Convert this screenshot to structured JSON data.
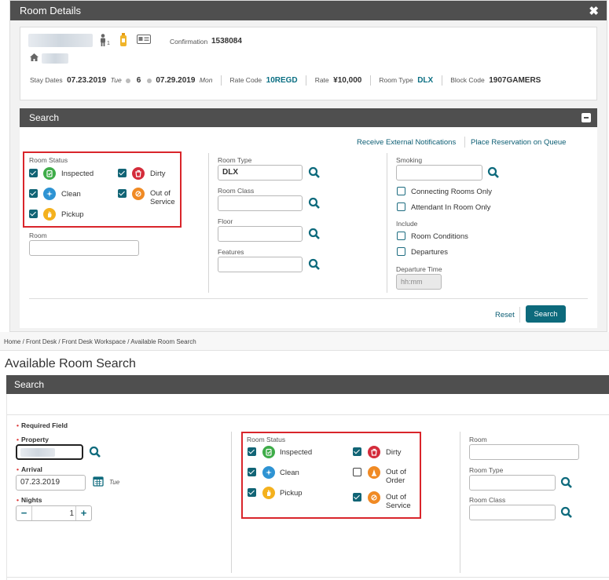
{
  "dialog": {
    "title": "Room Details",
    "close_icon": "close-icon",
    "confirmation_label": "Confirmation",
    "confirmation_number": "1538084",
    "adults_count": "1",
    "stay_dates_label": "Stay Dates",
    "arrival_date": "07.23.2019",
    "arrival_day": "Tue",
    "nights": "6",
    "departure_date": "07.29.2019",
    "departure_day": "Mon",
    "rate_code_label": "Rate Code",
    "rate_code": "10REGD",
    "rate_label": "Rate",
    "rate": "¥10,000",
    "room_type_label": "Room Type",
    "room_type": "DLX",
    "block_code_label": "Block Code",
    "block_code": "1907GAMERS"
  },
  "search": {
    "title": "Search",
    "receive_notifications": "Receive External Notifications",
    "place_on_queue": "Place Reservation on Queue",
    "room_status_label": "Room Status",
    "statuses": [
      {
        "label": "Inspected",
        "checked": true,
        "color": "#3eac48"
      },
      {
        "label": "Dirty",
        "checked": true,
        "color": "#d42c3b"
      },
      {
        "label": "Clean",
        "checked": true,
        "color": "#2e93d3"
      },
      {
        "label": "Out of Service",
        "checked": true,
        "color": "#f08a24"
      },
      {
        "label": "Pickup",
        "checked": true,
        "color": "#f4b11e"
      }
    ],
    "room_label": "Room",
    "room_type_label": "Room Type",
    "room_type_value": "DLX",
    "room_class_label": "Room Class",
    "floor_label": "Floor",
    "features_label": "Features",
    "smoking_label": "Smoking",
    "connecting_rooms": "Connecting Rooms Only",
    "attendant_in_room": "Attendant In Room Only",
    "include_label": "Include",
    "room_conditions": "Room Conditions",
    "departures": "Departures",
    "departure_time_label": "Departure Time",
    "departure_time_placeholder": "hh:mm",
    "reset": "Reset",
    "search_button": "Search"
  },
  "breadcrumb": "Home / Front Desk / Front Desk Workspace / Available Room Search",
  "available": {
    "page_title": "Available Room Search",
    "search_header": "Search",
    "required_field": "Required Field",
    "property_label": "Property",
    "arrival_label": "Arrival",
    "arrival_value": "07.23.2019",
    "arrival_day": "Tue",
    "nights_label": "Nights",
    "nights_value": "1",
    "room_status_label": "Room Status",
    "statuses": [
      {
        "label": "Inspected",
        "checked": true
      },
      {
        "label": "Dirty",
        "checked": true
      },
      {
        "label": "Clean",
        "checked": true
      },
      {
        "label": "Out of Order",
        "checked": false
      },
      {
        "label": "Pickup",
        "checked": true
      },
      {
        "label": "Out of Service",
        "checked": true
      }
    ],
    "room_label": "Room",
    "room_type_label": "Room Type",
    "room_class_label": "Room Class"
  },
  "accent_color": "#0d6a7c",
  "highlight_color": "#d9252b",
  "header_color": "#4f4f4f"
}
